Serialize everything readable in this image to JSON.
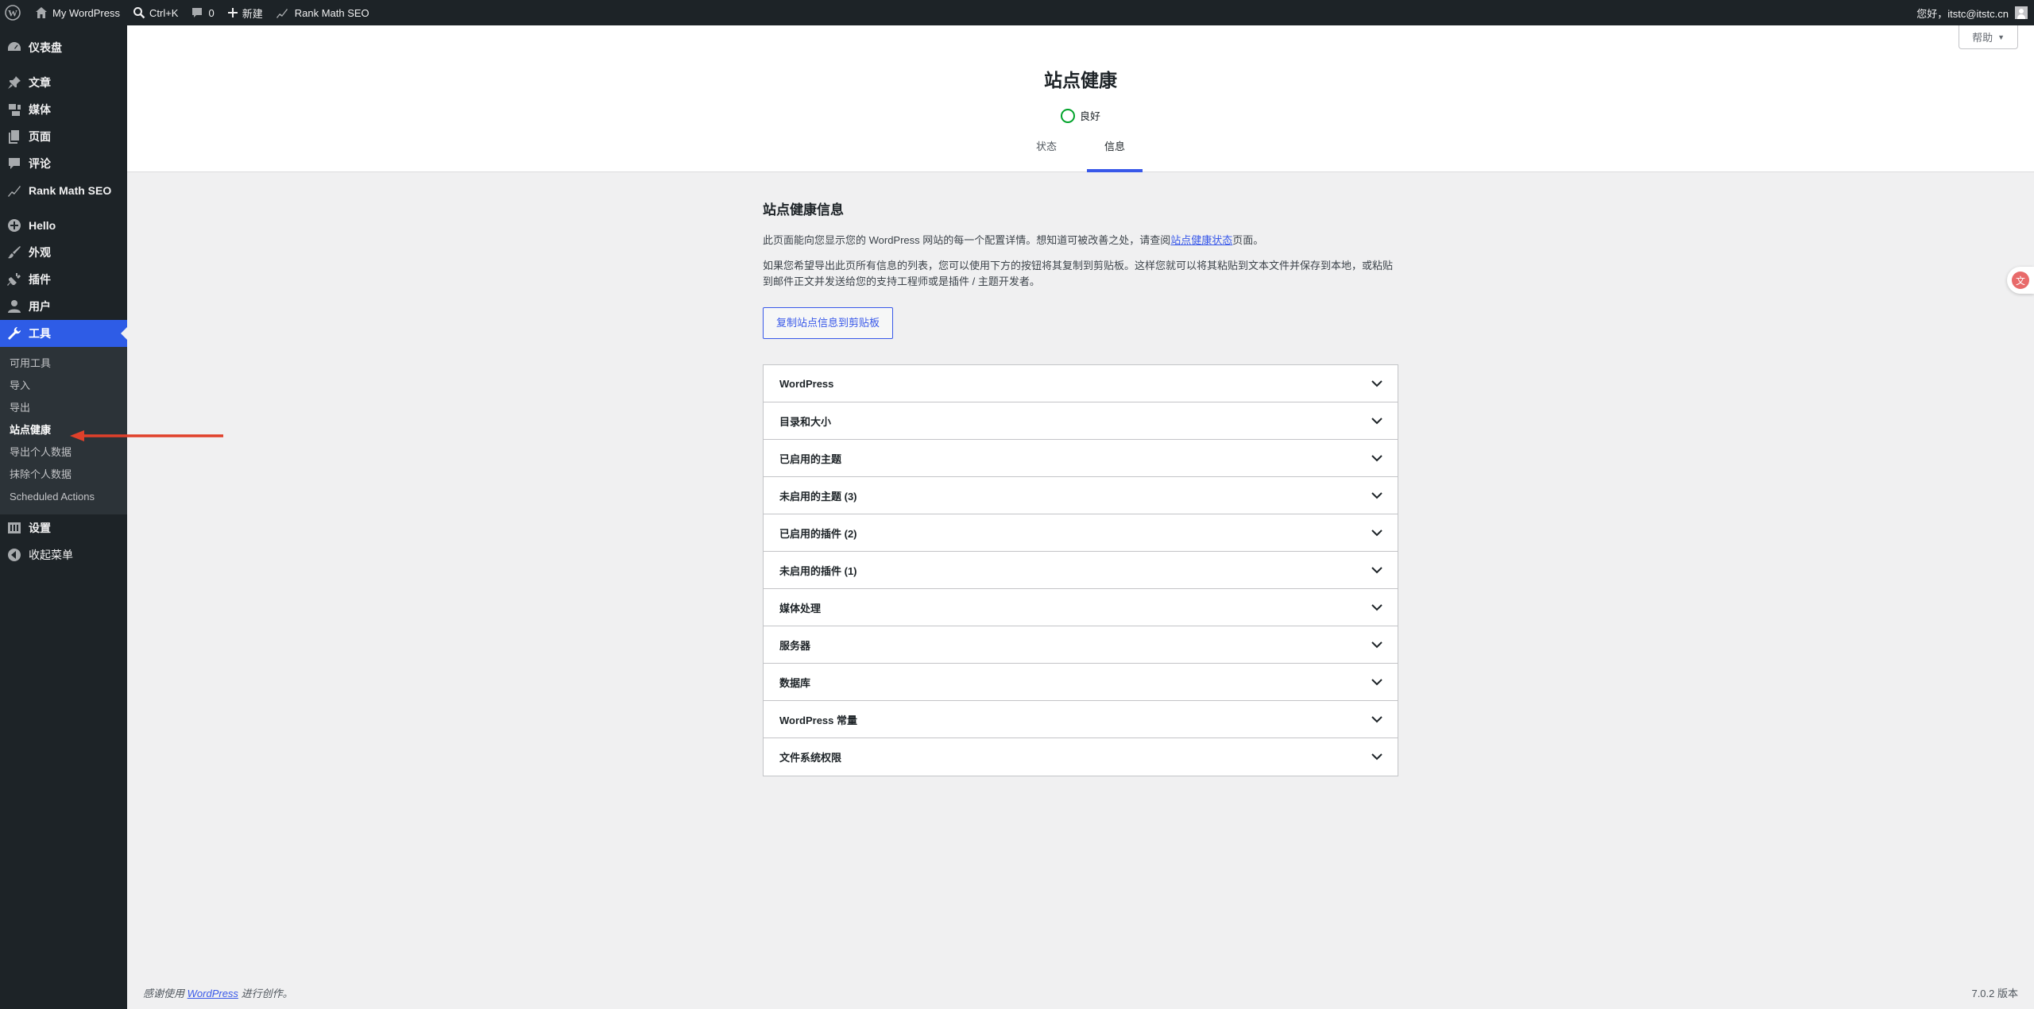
{
  "adminbar": {
    "site_name": "My WordPress",
    "search_shortcut": "Ctrl+K",
    "comments_count": "0",
    "new_label": "新建",
    "rankmath_label": "Rank Math SEO",
    "greeting": "您好，itstc@itstc.cn"
  },
  "sidebar": {
    "items": [
      {
        "label": "仪表盘",
        "icon": "dashboard-icon"
      },
      {
        "label": "文章",
        "icon": "pin-icon"
      },
      {
        "label": "媒体",
        "icon": "media-icon"
      },
      {
        "label": "页面",
        "icon": "pages-icon"
      },
      {
        "label": "评论",
        "icon": "comment-icon"
      },
      {
        "label": "Rank Math SEO",
        "icon": "rankmath-icon"
      },
      {
        "label": "Hello",
        "icon": "plus-circle-icon"
      },
      {
        "label": "外观",
        "icon": "brush-icon"
      },
      {
        "label": "插件",
        "icon": "plugin-icon"
      },
      {
        "label": "用户",
        "icon": "user-icon"
      },
      {
        "label": "工具",
        "icon": "wrench-icon"
      },
      {
        "label": "设置",
        "icon": "settings-icon"
      },
      {
        "label": "收起菜单",
        "icon": "collapse-icon"
      }
    ],
    "submenu": [
      "可用工具",
      "导入",
      "导出",
      "站点健康",
      "导出个人数据",
      "抹除个人数据",
      "Scheduled Actions"
    ]
  },
  "header": {
    "title": "站点健康",
    "status": "良好",
    "tabs": [
      "状态",
      "信息"
    ],
    "help": "帮助"
  },
  "main": {
    "section_title": "站点健康信息",
    "para1_before": "此页面能向您显示您的 WordPress 网站的每一个配置详情。想知道可被改善之处，请查阅",
    "para1_link": "站点健康状态",
    "para1_after": "页面。",
    "para2": "如果您希望导出此页所有信息的列表，您可以使用下方的按钮将其复制到剪贴板。这样您就可以将其粘贴到文本文件并保存到本地，或粘贴到邮件正文并发送给您的支持工程师或是插件 / 主题开发者。",
    "copy_button": "复制站点信息到剪贴板",
    "accordion": [
      "WordPress",
      "目录和大小",
      "已启用的主题",
      "未启用的主题 (3)",
      "已启用的插件 (2)",
      "未启用的插件 (1)",
      "媒体处理",
      "服务器",
      "数据库",
      "WordPress 常量",
      "文件系统权限"
    ]
  },
  "footer": {
    "thanks_before": "感谢使用",
    "thanks_link": "WordPress",
    "thanks_after": "进行创作。",
    "version": "7.0.2 版本"
  },
  "colors": {
    "accent": "#3858e9",
    "adminbar": "#1d2327",
    "good": "#00a32a",
    "annotation": "#e0402a"
  }
}
